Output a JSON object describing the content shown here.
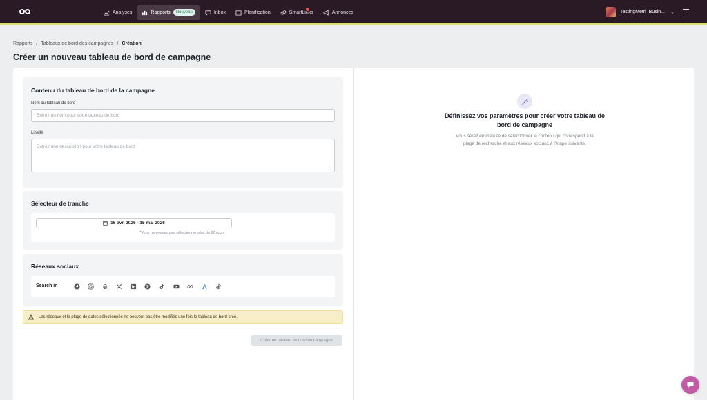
{
  "nav": {
    "items": [
      {
        "label": "Analyses",
        "icon": "chart-line-icon",
        "active": false
      },
      {
        "label": "Rapports",
        "icon": "bar-chart-icon",
        "active": true,
        "badge": "Nouveau"
      },
      {
        "label": "Inbox",
        "icon": "chat-bubble-icon",
        "active": false
      },
      {
        "label": "Planification",
        "icon": "calendar-icon",
        "active": false
      },
      {
        "label": "SmartLinks",
        "icon": "link-icon",
        "active": false
      },
      {
        "label": "Annonces",
        "icon": "megaphone-icon",
        "active": false
      }
    ],
    "account_name": "TestingMetri_Busin..."
  },
  "breadcrumb": [
    "Rapports",
    "/",
    "Tableaux de bord des campagnes",
    "/",
    "Création"
  ],
  "page_title": "Créer un nouveau tableau de bord de campagne",
  "content_card": {
    "title": "Contenu du tableau de bord de la campagne",
    "name_label": "Nom du tableau de bord",
    "name_placeholder": "Entrez un nom pour votre tableau de bord",
    "desc_label": "Libellé",
    "desc_placeholder": "Entrez une description pour votre tableau de bord"
  },
  "range_card": {
    "title": "Sélecteur de tranche",
    "date_range": "16 avr. 2026 - 15 mai 2026",
    "note": "*Vous ne pouvez pas sélectionner plus de 90 jours"
  },
  "social_card": {
    "title": "Réseaux sociaux",
    "search_in": "Search in",
    "networks": [
      "facebook-icon",
      "instagram-icon",
      "threads-icon",
      "x-icon",
      "linkedin-icon",
      "pinterest-icon",
      "tiktok-icon",
      "youtube-icon",
      "meta-icon",
      "google-ads-icon",
      "tiktok-ads-icon"
    ]
  },
  "warning": "Les réseaux et la plage de dates sélectionnés ne peuvent pas être modifiés une fois le tableau de bord créé.",
  "create_button": "Créer un tableau de bord de campagne",
  "empty_state": {
    "title": "Définissez vos paramètres pour créer votre tableau de bord de campagne",
    "description": "Vous serez en mesure de sélectionner le contenu qui correspond à la plage de recherche et aux réseaux sociaux à l'étape suivante."
  }
}
